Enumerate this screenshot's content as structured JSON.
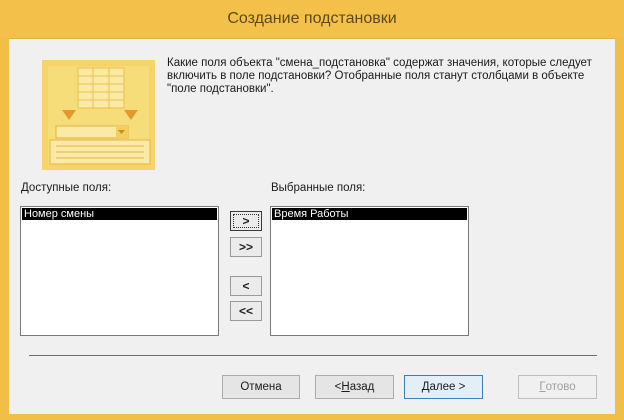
{
  "dialog": {
    "title": "Создание подстановки",
    "description": "Какие поля объекта \"смена_подстановка\" содержат значения, которые следует включить в поле подстановки? Отобранные поля станут столбцами в объекте \"поле подстановки\"."
  },
  "available": {
    "label": "Доступные поля:",
    "items": [
      "Номер смены"
    ]
  },
  "selected": {
    "label": "Выбранные поля:",
    "items": [
      "Время Работы"
    ]
  },
  "move_buttons": {
    "add_one": ">",
    "add_all": ">>",
    "remove_one": "<",
    "remove_all": "<<"
  },
  "footer": {
    "cancel": "Отмена",
    "back_prefix": "< ",
    "back_key": "Н",
    "back_rest": "азад",
    "next_key": "Д",
    "next_rest": "алее >",
    "finish_key": "Г",
    "finish_rest": "отово"
  },
  "colors": {
    "title_bar": "#f3c14a",
    "selection": "#000000",
    "client_bg": "#f0f0f0"
  }
}
